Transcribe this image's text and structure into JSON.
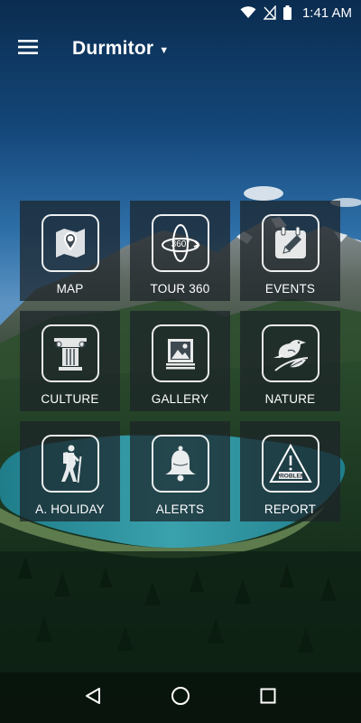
{
  "status_bar": {
    "time": "1:41 AM",
    "icons": [
      "wifi-icon",
      "no-signal-icon",
      "battery-icon"
    ]
  },
  "app_bar": {
    "menu_icon": "hamburger-menu-icon",
    "title": "Durmitor",
    "dropdown_icon": "caret-down-icon"
  },
  "tiles": [
    {
      "label": "MAP",
      "icon": "map-pin-icon"
    },
    {
      "label": "TOUR 360",
      "icon": "tour-360-icon",
      "icon_text": "360°"
    },
    {
      "label": "EVENTS",
      "icon": "calendar-edit-icon"
    },
    {
      "label": "CULTURE",
      "icon": "column-icon"
    },
    {
      "label": "GALLERY",
      "icon": "picture-icon"
    },
    {
      "label": "NATURE",
      "icon": "bird-icon"
    },
    {
      "label": "A. HOLIDAY",
      "icon": "hiker-icon"
    },
    {
      "label": "ALERTS",
      "icon": "bell-icon"
    },
    {
      "label": "REPORT",
      "icon": "warning-triangle-icon",
      "icon_text": "PROBLEM"
    }
  ],
  "nav_bar": {
    "buttons": [
      "back-triangle-icon",
      "home-circle-icon",
      "recents-square-icon"
    ]
  },
  "colors": {
    "tile_background": "#1c2228",
    "sky_top": "#0b2f52",
    "sky_mid": "#2d6fa6",
    "forest": "#15301c",
    "lake": "#2a8f9c"
  }
}
